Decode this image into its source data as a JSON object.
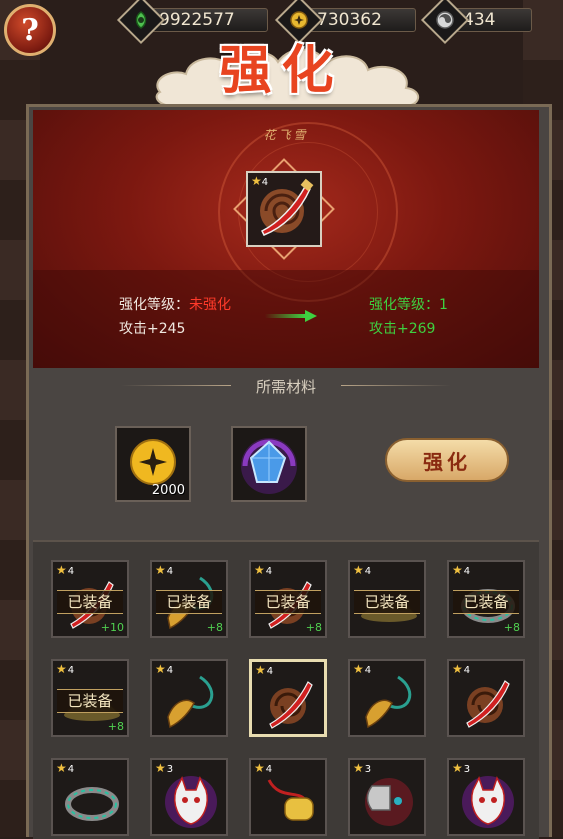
{
  "header": {
    "help_label": "?",
    "resources": [
      {
        "icon": "jade-icon",
        "value": "9922577"
      },
      {
        "icon": "gold-coin-icon",
        "value": "730362"
      },
      {
        "icon": "spirit-orb-icon",
        "value": "434"
      }
    ],
    "title": "强化"
  },
  "item": {
    "name": "花飞雪",
    "stars": "4",
    "current_level_label": "强化等级：",
    "current_level_value": "未强化",
    "current_attack": "攻击+245",
    "next_level_label": "强化等级：",
    "next_level_value": "1",
    "next_attack": "攻击+269"
  },
  "materials": {
    "title": "所需材料",
    "coin_cost": "2000",
    "enhance_button": "强化"
  },
  "inventory": [
    {
      "stars": "4",
      "type": "blade",
      "equipped": "已装备",
      "plus": "+10"
    },
    {
      "stars": "4",
      "type": "whip",
      "equipped": "已装备",
      "plus": "+8"
    },
    {
      "stars": "4",
      "type": "blade",
      "equipped": "已装备",
      "plus": "+8"
    },
    {
      "stars": "4",
      "type": "hat",
      "equipped": "已装备",
      "plus": ""
    },
    {
      "stars": "4",
      "type": "ring",
      "equipped": "已装备",
      "plus": "+8"
    },
    {
      "stars": "4",
      "type": "hat",
      "equipped": "已装备",
      "plus": "+8"
    },
    {
      "stars": "4",
      "type": "whip",
      "equipped": "",
      "plus": ""
    },
    {
      "stars": "4",
      "type": "blade",
      "equipped": "",
      "plus": "",
      "selected": true
    },
    {
      "stars": "4",
      "type": "whip",
      "equipped": "",
      "plus": ""
    },
    {
      "stars": "4",
      "type": "blade",
      "equipped": "",
      "plus": ""
    },
    {
      "stars": "4",
      "type": "ring",
      "equipped": "",
      "plus": ""
    },
    {
      "stars": "3",
      "type": "mask",
      "equipped": "",
      "plus": ""
    },
    {
      "stars": "4",
      "type": "charm",
      "equipped": "",
      "plus": ""
    },
    {
      "stars": "3",
      "type": "axe",
      "equipped": "",
      "plus": ""
    },
    {
      "stars": "3",
      "type": "mask",
      "equipped": "",
      "plus": ""
    }
  ]
}
